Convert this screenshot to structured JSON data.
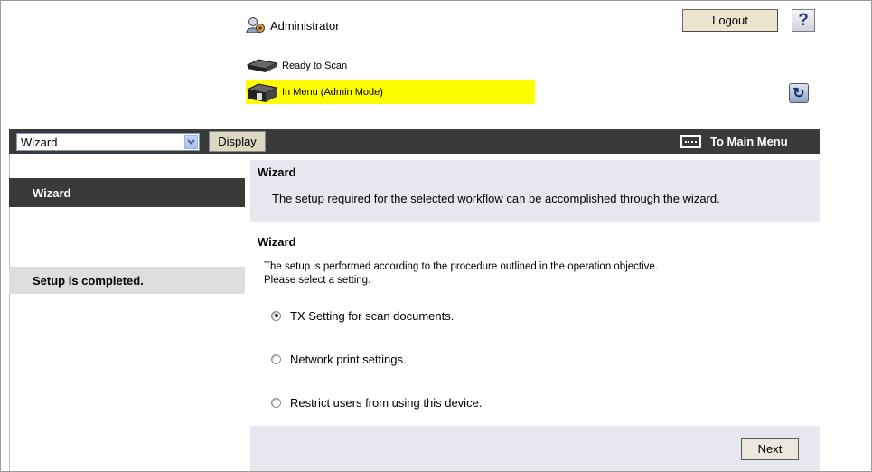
{
  "header": {
    "user": {
      "icon": "admin-user-icon",
      "label": "Administrator"
    },
    "logout_label": "Logout",
    "help_label": "?",
    "status": [
      {
        "icon": "printer-icon",
        "text": "Ready to Scan"
      },
      {
        "icon": "printer-icon",
        "text": "In Menu (Admin Mode)",
        "highlight": "#ffff00"
      }
    ],
    "refresh_icon": "refresh-icon"
  },
  "toolbar": {
    "select_value": "Wizard",
    "display_label": "Display",
    "main_menu_label": "To Main Menu",
    "main_menu_icon": "main-menu-icon"
  },
  "sidebar": {
    "items": [
      {
        "label": "Wizard",
        "state": "active"
      },
      {
        "label": "Setup is completed.",
        "state": "inactive"
      }
    ]
  },
  "content": {
    "info": {
      "title": "Wizard",
      "description": "The setup required for the selected workflow can be accomplished through the wizard."
    },
    "wizard": {
      "title": "Wizard",
      "description_line1": "The setup is performed according to the procedure outlined in the operation objective.",
      "description_line2": "Please select a setting.",
      "options": [
        {
          "label": "TX Setting for scan documents.",
          "checked": true
        },
        {
          "label": "Network print settings.",
          "checked": false
        },
        {
          "label": "Restrict users from using this device.",
          "checked": false
        }
      ]
    },
    "next_label": "Next"
  },
  "colors": {
    "dark_bar": "#3a3a3a",
    "panel": "#e7e7ef",
    "highlight": "#ffff00"
  }
}
